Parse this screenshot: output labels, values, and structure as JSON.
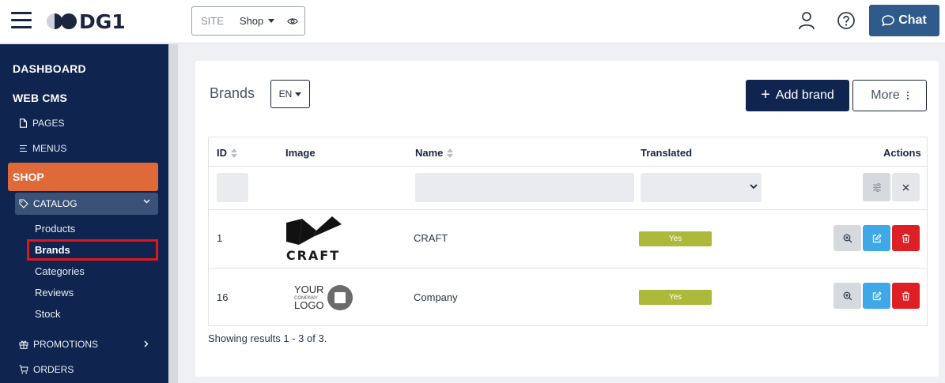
{
  "app": {
    "logo_text": "DG1",
    "site_label": "SITE",
    "site_value": "Shop",
    "chat_label": "Chat"
  },
  "sidebar": {
    "dashboard": "DASHBOARD",
    "web_cms": "WEB CMS",
    "pages": "PAGES",
    "menus": "MENUS",
    "shop": "SHOP",
    "catalog": "CATALOG",
    "catalog_items": [
      "Products",
      "Brands",
      "Categories",
      "Reviews",
      "Stock"
    ],
    "promotions": "PROMOTIONS",
    "orders": "ORDERS"
  },
  "main": {
    "title": "Brands",
    "language": "EN",
    "add_button": "Add brand",
    "more_button": "More",
    "columns": {
      "id": "ID",
      "image": "Image",
      "name": "Name",
      "translated": "Translated",
      "actions": "Actions"
    },
    "rows": [
      {
        "id": "1",
        "name": "CRAFT",
        "translated": "Yes",
        "logo_text": "CRAFT"
      },
      {
        "id": "16",
        "name": "Company",
        "translated": "Yes",
        "logo_lines": [
          "YOUR",
          "COMPANY",
          "LOGO"
        ]
      }
    ],
    "showing": "Showing results 1 - 3 of 3."
  },
  "colors": {
    "sidebar_bg": "#0f2550",
    "shop_accent": "#e0693a",
    "primary": "#0f2550",
    "chat": "#2e5a8c",
    "badge_yes": "#adb93a",
    "edit": "#3fa9e8",
    "delete": "#dc2026",
    "highlight": "#e0161b"
  }
}
